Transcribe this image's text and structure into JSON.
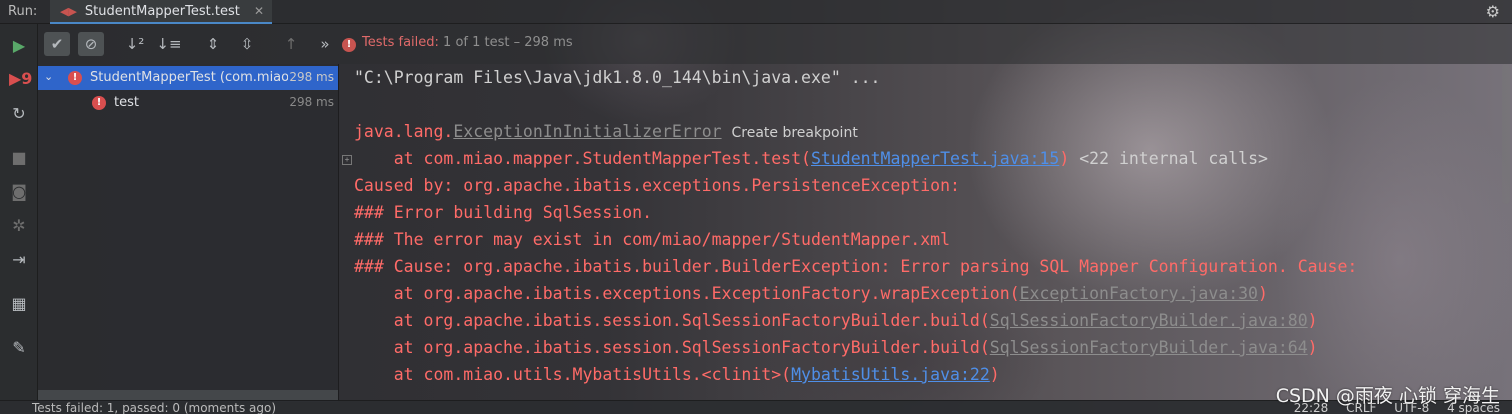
{
  "topbar": {
    "run_label": "Run:",
    "tab_title": "StudentMapperTest.test",
    "tab_close": "✕",
    "gear_icon": "gear-icon"
  },
  "toolbar": {
    "status_failed": "Tests failed:",
    "status_rest": "1 of 1 test – 298 ms",
    "more": "»"
  },
  "tree": {
    "items": [
      {
        "label": "StudentMapperTest (com.miao",
        "time": "298 ms",
        "selected": true
      },
      {
        "label": "test",
        "time": "298 ms",
        "selected": false
      }
    ]
  },
  "console": {
    "cmd": "\"C:\\Program Files\\Java\\jdk1.8.0_144\\bin\\java.exe\" ...",
    "exc_prefix": "java.lang.",
    "exc_name": "ExceptionInInitializerError",
    "create_bp": "Create breakpoint",
    "at1_prefix": "    at com.miao.mapper.StudentMapperTest.test(",
    "at1_link": "StudentMapperTest.java:15",
    "at1_suffix": ")",
    "internal_calls": "<22 internal calls>",
    "caused_by": "Caused by: org.apache.ibatis.exceptions.PersistenceException:",
    "err1": "### Error building SqlSession.",
    "err2": "### The error may exist in com/miao/mapper/StudentMapper.xml",
    "err3": "### Cause: org.apache.ibatis.builder.BuilderException: Error parsing SQL Mapper Configuration. Cause: ",
    "at2_prefix": "    at org.apache.ibatis.exceptions.ExceptionFactory.wrapException(",
    "at2_link": "ExceptionFactory.java:30",
    "at3_prefix": "    at org.apache.ibatis.session.SqlSessionFactoryBuilder.build(",
    "at3_link": "SqlSessionFactoryBuilder.java:80",
    "at4_prefix": "    at org.apache.ibatis.session.SqlSessionFactoryBuilder.build(",
    "at4_link": "SqlSessionFactoryBuilder.java:64",
    "at5_prefix": "    at com.miao.utils.MybatisUtils.<clinit>(",
    "at5_link": "MybatisUtils.java:22",
    "close_paren": ")"
  },
  "statusbar": {
    "left": "Tests failed: 1, passed: 0 (moments ago)",
    "time": "22:28",
    "line_sep": "CRLF",
    "encoding": "UTF-8",
    "indent": "4 spaces"
  },
  "watermark": "CSDN @雨夜 心锁 穿海生",
  "colors": {
    "fail_red": "#ff6b68",
    "link_blue": "#4f8fe8",
    "selection_blue": "#2f65ca",
    "run_green": "#59a869"
  }
}
